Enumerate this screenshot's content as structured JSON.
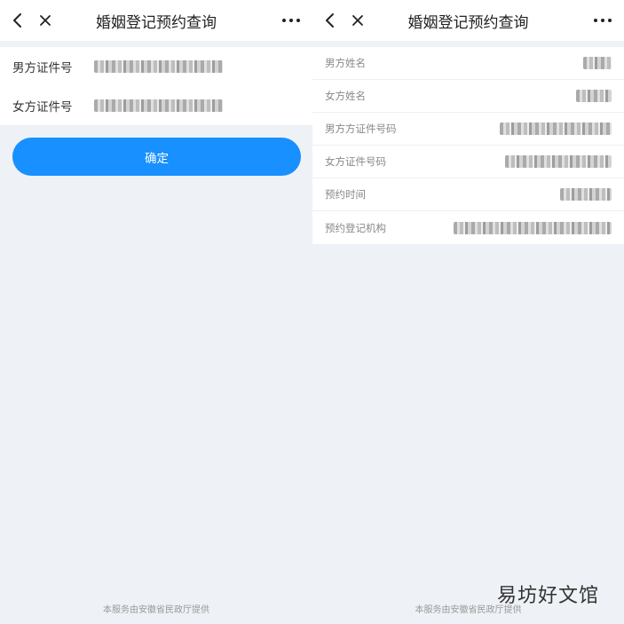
{
  "left": {
    "title": "婚姻登记预约查询",
    "form": [
      {
        "label": "男方证件号"
      },
      {
        "label": "女方证件号"
      }
    ],
    "confirm_label": "确定",
    "footer": "本服务由安徽省民政厅提供"
  },
  "right": {
    "title": "婚姻登记预约查询",
    "rows": [
      {
        "label": "男方姓名"
      },
      {
        "label": "女方姓名"
      },
      {
        "label": "男方方证件号码"
      },
      {
        "label": "女方证件号码"
      },
      {
        "label": "预约时间"
      },
      {
        "label": "预约登记机构"
      }
    ],
    "footer": "本服务由安徽省民政厅提供"
  },
  "watermark": "易坊好文馆",
  "icons": {
    "back": "chevron-left-icon",
    "close": "close-icon",
    "more": "more-horizontal-icon"
  },
  "colors": {
    "accent": "#1890ff",
    "background": "#eef1f5"
  }
}
